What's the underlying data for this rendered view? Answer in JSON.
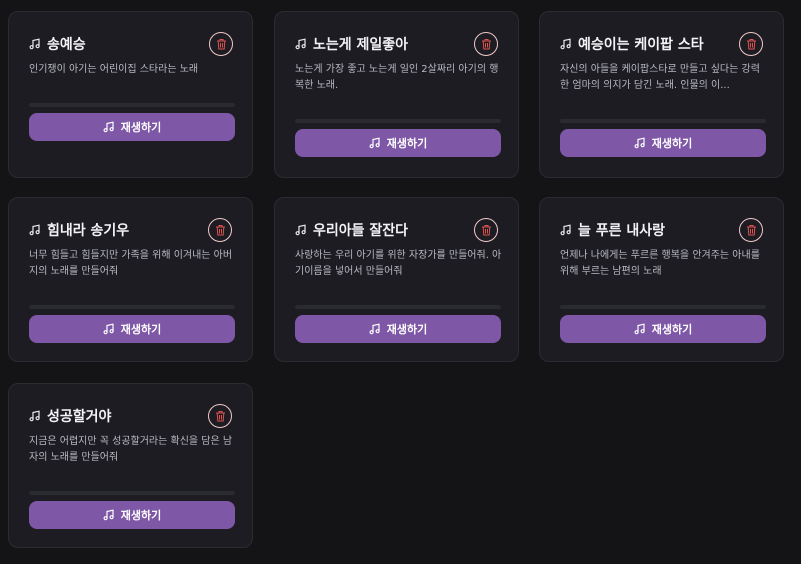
{
  "songs": [
    {
      "title": "송예승",
      "description": "인기쟁이 아기는 어린이집 스타라는 노래",
      "play_label": "재생하기",
      "delete_icon": "trash-icon",
      "title_icon": "music-note-icon"
    },
    {
      "title": "노는게 제일좋아",
      "description": "노는게 가장 좋고 노는게 일인 2살짜리 아기의 행복한 노래.",
      "play_label": "재생하기",
      "delete_icon": "trash-icon",
      "title_icon": "music-note-icon"
    },
    {
      "title": "예승이는 케이팝 스타",
      "description": "자신의 아들을 케이팝스타로 만들고 싶다는 강력한 엄마의 의지가 담긴 노래. 인물의 이...",
      "play_label": "재생하기",
      "delete_icon": "trash-icon",
      "title_icon": "music-note-icon"
    },
    {
      "title": "힘내라 송기우",
      "description": "너무 힘들고 힘들지만 가족을 위해 이겨내는 아버지의 노래를 만들어줘",
      "play_label": "재생하기",
      "delete_icon": "trash-icon",
      "title_icon": "music-note-icon"
    },
    {
      "title": "우리아들 잘잔다",
      "description": "사랑하는 우리 아기를 위한 자장가를 만들어줘. 아기이름을 넣어서 만들어줘",
      "play_label": "재생하기",
      "delete_icon": "trash-icon",
      "title_icon": "music-note-icon"
    },
    {
      "title": "늘 푸른 내사랑",
      "description": "언제나 나에게는 푸르른 행복을 안겨주는 아내를 위해 부르는 남편의 노래",
      "play_label": "재생하기",
      "delete_icon": "trash-icon",
      "title_icon": "music-note-icon"
    },
    {
      "title": "성공할거야",
      "description": "지금은 어렵지만 꼭 성공할거라는 확신을 담은 남자의 노래를 만들어줘",
      "play_label": "재생하기",
      "delete_icon": "trash-icon",
      "title_icon": "music-note-icon"
    }
  ],
  "colors": {
    "background": "#141417",
    "card": "#1c1c22",
    "accent": "#7e57a7",
    "delete": "#e0524f"
  }
}
